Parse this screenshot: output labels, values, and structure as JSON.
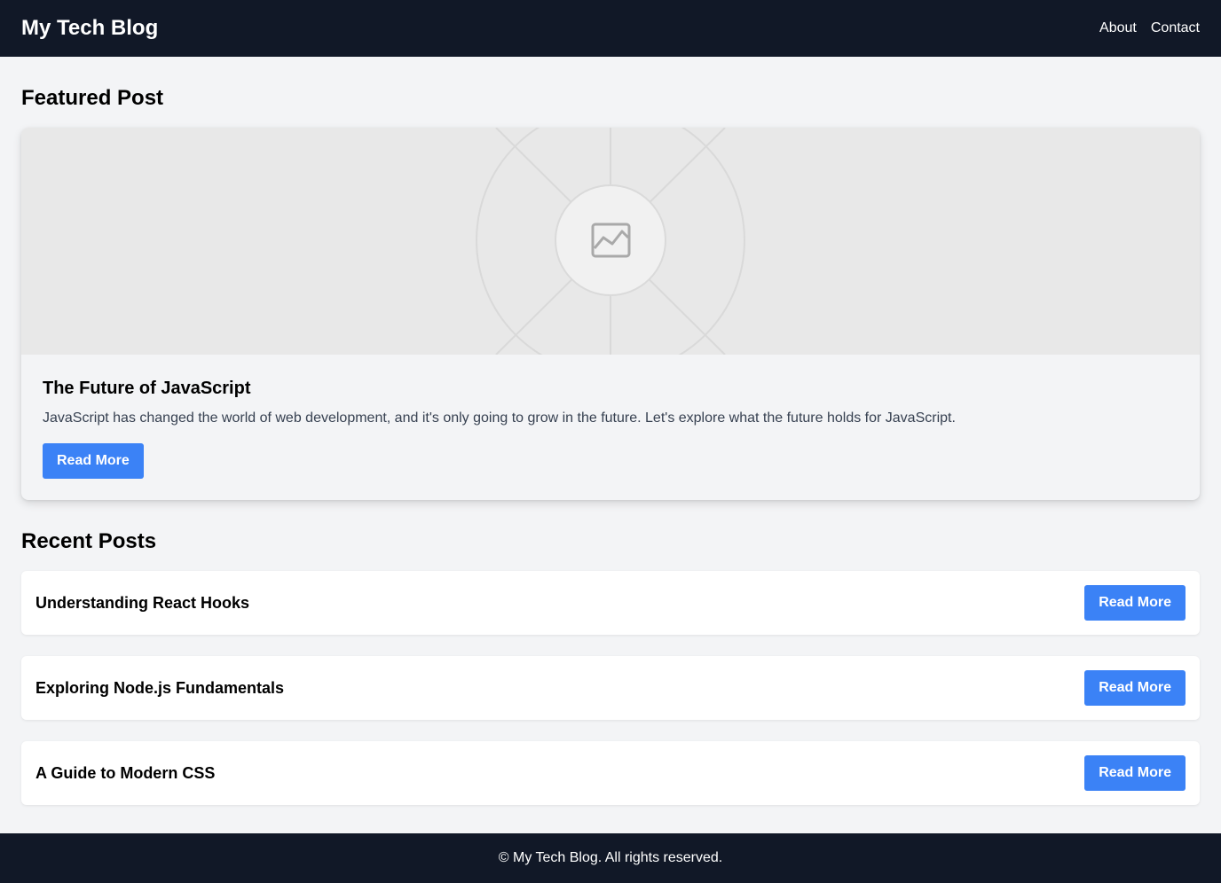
{
  "header": {
    "brand": "My Tech Blog",
    "nav": [
      "About",
      "Contact"
    ]
  },
  "featured": {
    "section_title": "Featured Post",
    "image_icon": "image-icon",
    "title": "The Future of JavaScript",
    "description": "JavaScript has changed the world of web development, and it's only going to grow in the future. Let's explore what the future holds for JavaScript.",
    "button": "Read More"
  },
  "recent": {
    "section_title": "Recent Posts",
    "posts": [
      {
        "title": "Understanding React Hooks",
        "button": "Read More"
      },
      {
        "title": "Exploring Node.js Fundamentals",
        "button": "Read More"
      },
      {
        "title": "A Guide to Modern CSS",
        "button": "Read More"
      }
    ]
  },
  "footer": {
    "text": "© My Tech Blog. All rights reserved."
  },
  "colors": {
    "header_bg": "#111827",
    "accent": "#3b82f6",
    "page_bg": "#f3f4f6"
  }
}
